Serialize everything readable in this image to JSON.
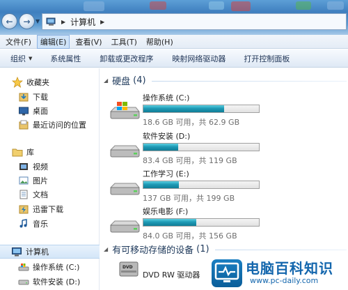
{
  "address": {
    "location": "计算机"
  },
  "menu": [
    "文件(F)",
    "编辑(E)",
    "查看(V)",
    "工具(T)",
    "帮助(H)"
  ],
  "menu_active_index": 1,
  "toolbar": {
    "organize": "组织",
    "system_properties": "系统属性",
    "uninstall": "卸载或更改程序",
    "map_drive": "映射网络驱动器",
    "control_panel": "打开控制面板"
  },
  "nav": {
    "favorites": {
      "label": "收藏夹",
      "items": [
        "下载",
        "桌面",
        "最近访问的位置"
      ]
    },
    "libraries": {
      "label": "库",
      "items": [
        "视频",
        "图片",
        "文档",
        "迅雷下载",
        "音乐"
      ]
    },
    "computer": {
      "label": "计算机",
      "items": [
        "操作系统 (C:)",
        "软件安装 (D:)"
      ]
    }
  },
  "hard_disks": {
    "title": "硬盘",
    "count": "(4)",
    "drives": [
      {
        "name": "操作系统 (C:)",
        "info": "18.6 GB 可用，共 62.9 GB",
        "used_fraction": 0.7,
        "icon": "windows-drive-icon"
      },
      {
        "name": "软件安装 (D:)",
        "info": "83.4 GB 可用，共 119 GB",
        "used_fraction": 0.3,
        "icon": "hard-drive-icon"
      },
      {
        "name": "工作学习 (E:)",
        "info": "137 GB 可用，共 199 GB",
        "used_fraction": 0.31,
        "icon": "hard-drive-icon"
      },
      {
        "name": "娱乐电影 (F:)",
        "info": "84.0 GB 可用，共 156 GB",
        "used_fraction": 0.46,
        "icon": "hard-drive-icon"
      }
    ]
  },
  "removable": {
    "title": "有可移动存储的设备",
    "count": "(1)",
    "drives": [
      {
        "name": "DVD RW 驱动器",
        "icon": "dvd-drive-icon"
      }
    ]
  },
  "watermark": {
    "title": "电脑百科知识",
    "url": "www.pc-daily.com"
  }
}
